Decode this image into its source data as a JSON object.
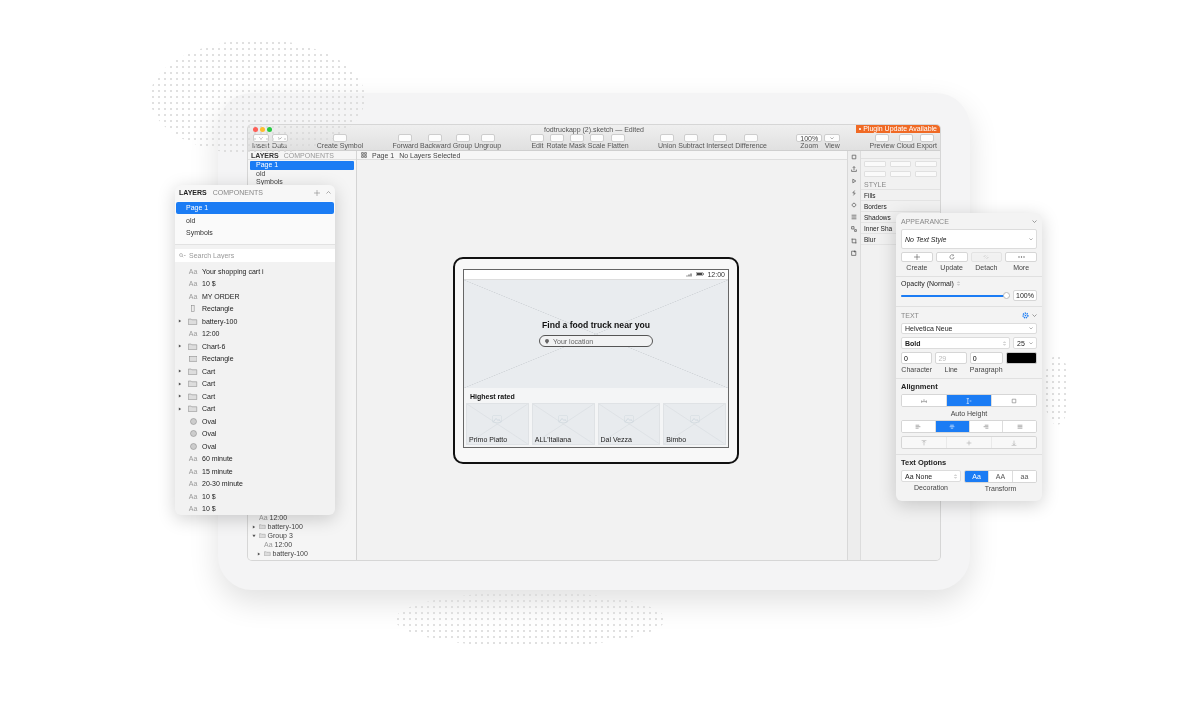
{
  "window": {
    "title": "fodtruckapp (2).sketch — Edited",
    "notice": "• Plugin Update Available"
  },
  "toolbar": [
    {
      "items": [
        {
          "label": "Insert",
          "kind": "menu"
        },
        {
          "label": "Data",
          "kind": "menu"
        }
      ]
    },
    {
      "items": [
        {
          "label": "Create Symbol",
          "kind": "button"
        }
      ]
    },
    {
      "items": [
        {
          "label": "Forward",
          "kind": "button"
        },
        {
          "label": "Backward",
          "kind": "button"
        },
        {
          "label": "Group",
          "kind": "button"
        },
        {
          "label": "Ungroup",
          "kind": "button"
        }
      ]
    },
    {
      "items": [
        {
          "label": "Edit",
          "kind": "button"
        },
        {
          "label": "Rotate",
          "kind": "button"
        },
        {
          "label": "Mask",
          "kind": "button"
        },
        {
          "label": "Scale",
          "kind": "button"
        },
        {
          "label": "Flatten",
          "kind": "button"
        }
      ]
    },
    {
      "items": [
        {
          "label": "Union",
          "kind": "button"
        },
        {
          "label": "Subtract",
          "kind": "button"
        },
        {
          "label": "Intersect",
          "kind": "button"
        },
        {
          "label": "Difference",
          "kind": "button"
        }
      ]
    },
    {
      "items": [
        {
          "label": "Zoom",
          "kind": "zoom",
          "value": "100%"
        },
        {
          "label": "View",
          "kind": "menu"
        }
      ]
    },
    {
      "items": [
        {
          "label": "Preview",
          "kind": "button"
        },
        {
          "label": "Cloud",
          "kind": "button"
        },
        {
          "label": "Export",
          "kind": "button"
        }
      ]
    }
  ],
  "sidebar": {
    "tabs": [
      {
        "label": "LAYERS",
        "selected": true
      },
      {
        "label": "COMPONENTS",
        "selected": false
      }
    ],
    "pages": [
      {
        "label": "Page 1",
        "selected": true
      },
      {
        "label": "old",
        "selected": false
      },
      {
        "label": "Symbols",
        "selected": false
      }
    ],
    "layers": [
      {
        "kind": "text",
        "glyph": "Aa",
        "name": "12:00"
      },
      {
        "kind": "group",
        "name": "battery-100",
        "expanded": false
      },
      {
        "kind": "group",
        "name": "Group 3",
        "expanded": true,
        "children": [
          {
            "kind": "text",
            "glyph": "Aa",
            "name": "12:00"
          },
          {
            "kind": "group",
            "name": "battery-100",
            "expanded": false
          }
        ]
      }
    ]
  },
  "canvas_bar": {
    "page": "Page 1",
    "status": "No Layers Selected"
  },
  "inspector": {
    "section": "STYLE",
    "rows": [
      "Fills",
      "Borders",
      "Shadows",
      "Inner Sha",
      "Blur"
    ]
  },
  "artboard": {
    "time": "12:00",
    "headline": "Find a food truck near you",
    "search_placeholder": "Your location",
    "section_title": "Highest rated",
    "cards": [
      {
        "name": "Primo Piatto"
      },
      {
        "name": "ALL'Italiana"
      },
      {
        "name": "Dal Vezza"
      },
      {
        "name": "Bimbo"
      }
    ]
  },
  "layers_panel": {
    "tabs": [
      {
        "label": "LAYERS",
        "selected": true
      },
      {
        "label": "COMPONENTS",
        "selected": false
      }
    ],
    "pages": [
      {
        "label": "Page 1",
        "selected": true
      },
      {
        "label": "old",
        "selected": false
      },
      {
        "label": "Symbols",
        "selected": false
      }
    ],
    "search": {
      "placeholder": "Search Layers"
    },
    "layers": [
      {
        "kind": "text",
        "glyph": "Aa",
        "name": "Your shopping cart i"
      },
      {
        "kind": "text",
        "glyph": "Aa",
        "name": "10 $"
      },
      {
        "kind": "text",
        "glyph": "Aa",
        "name": "MY ORDER"
      },
      {
        "kind": "bar",
        "name": "Rectangle"
      },
      {
        "kind": "group",
        "name": "battery-100",
        "expanded": false
      },
      {
        "kind": "text",
        "glyph": "Aa",
        "name": "12:00"
      },
      {
        "kind": "group",
        "name": "Chart-6",
        "expanded": false
      },
      {
        "kind": "rect",
        "name": "Rectangle"
      },
      {
        "kind": "group",
        "name": "Cart",
        "expanded": false
      },
      {
        "kind": "group",
        "name": "Cart",
        "expanded": false
      },
      {
        "kind": "group",
        "name": "Cart",
        "expanded": false
      },
      {
        "kind": "group",
        "name": "Cart",
        "expanded": false
      },
      {
        "kind": "oval",
        "name": "Oval"
      },
      {
        "kind": "oval",
        "name": "Oval"
      },
      {
        "kind": "oval",
        "name": "Oval"
      },
      {
        "kind": "text",
        "glyph": "Aa",
        "name": "60 minute"
      },
      {
        "kind": "text",
        "glyph": "Aa",
        "name": "15 minute"
      },
      {
        "kind": "text",
        "glyph": "Aa",
        "name": "20-30 minute"
      },
      {
        "kind": "text",
        "glyph": "Aa",
        "name": "10 $"
      },
      {
        "kind": "text",
        "glyph": "Aa",
        "name": "10 $"
      }
    ]
  },
  "text_panel": {
    "appearance": {
      "title": "APPEARANCE",
      "text_style": "No Text Style",
      "actions": [
        {
          "kind": "create",
          "label": "Create",
          "disabled": false
        },
        {
          "kind": "update",
          "label": "Update",
          "disabled": false
        },
        {
          "kind": "detach",
          "label": "Detach",
          "disabled": true
        },
        {
          "kind": "more",
          "label": "More",
          "disabled": false
        }
      ],
      "opacity_label": "Opacity (Normal)",
      "opacity": {
        "level": 0.97
      },
      "opacity_value": "100%"
    },
    "text": {
      "title": "TEXT",
      "font": "Helvetica Neue",
      "weight": "Bold",
      "size": "25",
      "metrics": [
        {
          "label": "Character",
          "value": "0"
        },
        {
          "label": "Line",
          "placeholder": "29"
        },
        {
          "label": "Paragraph",
          "value": "0"
        }
      ]
    },
    "alignment": {
      "title": "Alignment",
      "sizing": [
        {
          "kind": "width",
          "selected": false
        },
        {
          "kind": "height",
          "selected": true
        },
        {
          "kind": "fixed",
          "selected": false
        }
      ],
      "sizing_label": "Auto Height",
      "horizontal": [
        {
          "kind": "left",
          "selected": false
        },
        {
          "kind": "center",
          "selected": true
        },
        {
          "kind": "right",
          "selected": false
        },
        {
          "kind": "justify",
          "selected": false
        }
      ],
      "vertical": [
        {
          "kind": "top",
          "disabled": true
        },
        {
          "kind": "middle",
          "disabled": true
        },
        {
          "kind": "bottom",
          "disabled": true
        }
      ]
    },
    "options": {
      "title": "Text Options",
      "decoration": "Aa None",
      "decoration_label": "Decoration",
      "transform": [
        {
          "label": "Aa",
          "selected": true
        },
        {
          "label": "AA",
          "selected": false
        },
        {
          "label": "aa",
          "selected": false
        }
      ],
      "transform_label": "Transform"
    }
  }
}
